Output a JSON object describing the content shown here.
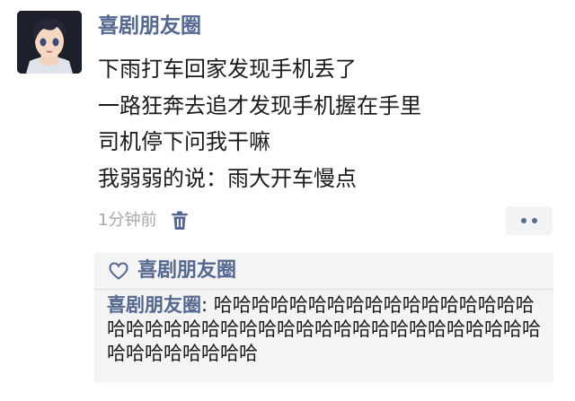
{
  "post": {
    "author": "喜剧朋友圈",
    "lines": [
      "下雨打车回家发现手机丢了",
      "一路狂奔去追才发现手机握在手里",
      "司机停下问我干嘛",
      "我弱弱的说：雨大开车慢点"
    ],
    "time": "1分钟前"
  },
  "likes": {
    "names": "喜剧朋友圈"
  },
  "comment": {
    "author": "喜剧朋友圈",
    "separator": ": ",
    "text": "哈哈哈哈哈哈哈哈哈哈哈哈哈哈哈哈哈哈哈哈哈哈哈哈哈哈哈哈哈哈哈哈哈哈哈哈哈哈哈哈哈哈哈哈哈哈哈哈"
  },
  "colors": {
    "name_link": "#55688f",
    "text": "#1b1b1b",
    "muted": "#a8a8a8",
    "panel": "#f4f4f4"
  },
  "icons": {
    "avatar": "anime-avatar",
    "delete": "trash-icon",
    "more": "more-dots-icon",
    "like": "heart-outline-icon"
  }
}
